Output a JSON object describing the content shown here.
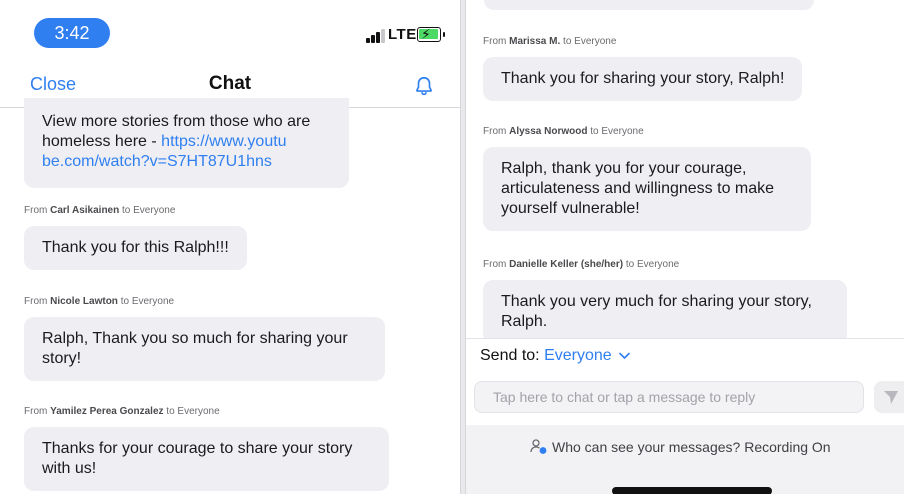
{
  "left": {
    "status": {
      "time": "3:42",
      "network": "LTE"
    },
    "nav": {
      "close_label": "Close",
      "title": "Chat"
    },
    "first_bubble": {
      "text": "View more stories from those who are homeless here - ",
      "link": "https://www.youtu be.com/watch?v=S7HT87U1hns"
    },
    "messages": [
      {
        "from_prefix": "From",
        "sender": "Carl Asikainen",
        "to": "to",
        "recipient": "Everyone",
        "text": "Thank you for this Ralph!!!"
      },
      {
        "from_prefix": "From",
        "sender": "Nicole Lawton",
        "to": "to",
        "recipient": "Everyone",
        "text": "Ralph, Thank you so much for sharing your story!"
      },
      {
        "from_prefix": "From",
        "sender": "Yamilez Perea Gonzalez",
        "to": "to",
        "recipient": "Everyone",
        "text": "Thanks for your courage to share your story with us!"
      }
    ]
  },
  "right": {
    "messages": [
      {
        "from_prefix": "From",
        "sender": "Marissa M.",
        "to": "to",
        "recipient": "Everyone",
        "text": "Thank you for sharing your story, Ralph!"
      },
      {
        "from_prefix": "From",
        "sender": "Alyssa Norwood",
        "to": "to",
        "recipient": "Everyone",
        "text": "Ralph, thank you for your courage, articulateness and willingness to make yourself vulnerable!"
      },
      {
        "from_prefix": "From",
        "sender": "Danielle Keller (she/her)",
        "to": "to",
        "recipient": "Everyone",
        "text": "Thank you very much for sharing your story, Ralph."
      }
    ],
    "composer": {
      "send_to_label": "Send to:",
      "send_to_value": "Everyone",
      "input_placeholder": "Tap here to chat or tap a message to reply",
      "input_value": "",
      "who_can_see": "Who can see your messages? Recording On"
    }
  },
  "colors": {
    "accent": "#2f7ff0",
    "bubble": "#efeff3",
    "battery": "#4cd964"
  },
  "icons": [
    "signal-icon",
    "battery-charging-icon",
    "bell-icon",
    "chevron-down-icon",
    "send-icon",
    "people-icon"
  ]
}
